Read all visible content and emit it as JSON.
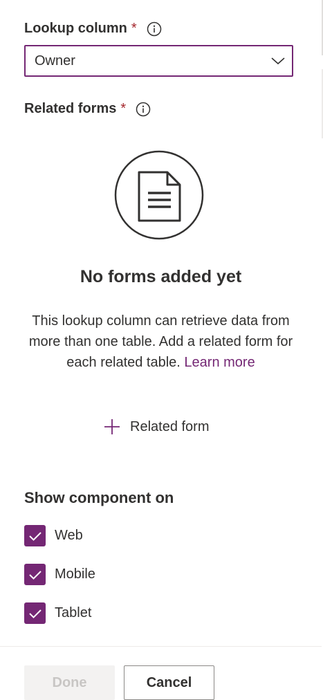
{
  "lookup": {
    "label": "Lookup column",
    "required_mark": "*",
    "info_icon": "info-icon",
    "selected": "Owner"
  },
  "related_forms": {
    "label": "Related forms",
    "required_mark": "*",
    "info_icon": "info-icon",
    "empty_title": "No forms added yet",
    "empty_desc": "This lookup column can retrieve data from more than one table. Add a related form for each related table.",
    "learn_more": "Learn more",
    "add_label": "Related form"
  },
  "show_on": {
    "title": "Show component on",
    "options": [
      {
        "label": "Web",
        "checked": true
      },
      {
        "label": "Mobile",
        "checked": true
      },
      {
        "label": "Tablet",
        "checked": true
      }
    ]
  },
  "footer": {
    "done": "Done",
    "cancel": "Cancel"
  },
  "colors": {
    "accent": "#742774",
    "required": "#a4262c",
    "text": "#323130"
  }
}
